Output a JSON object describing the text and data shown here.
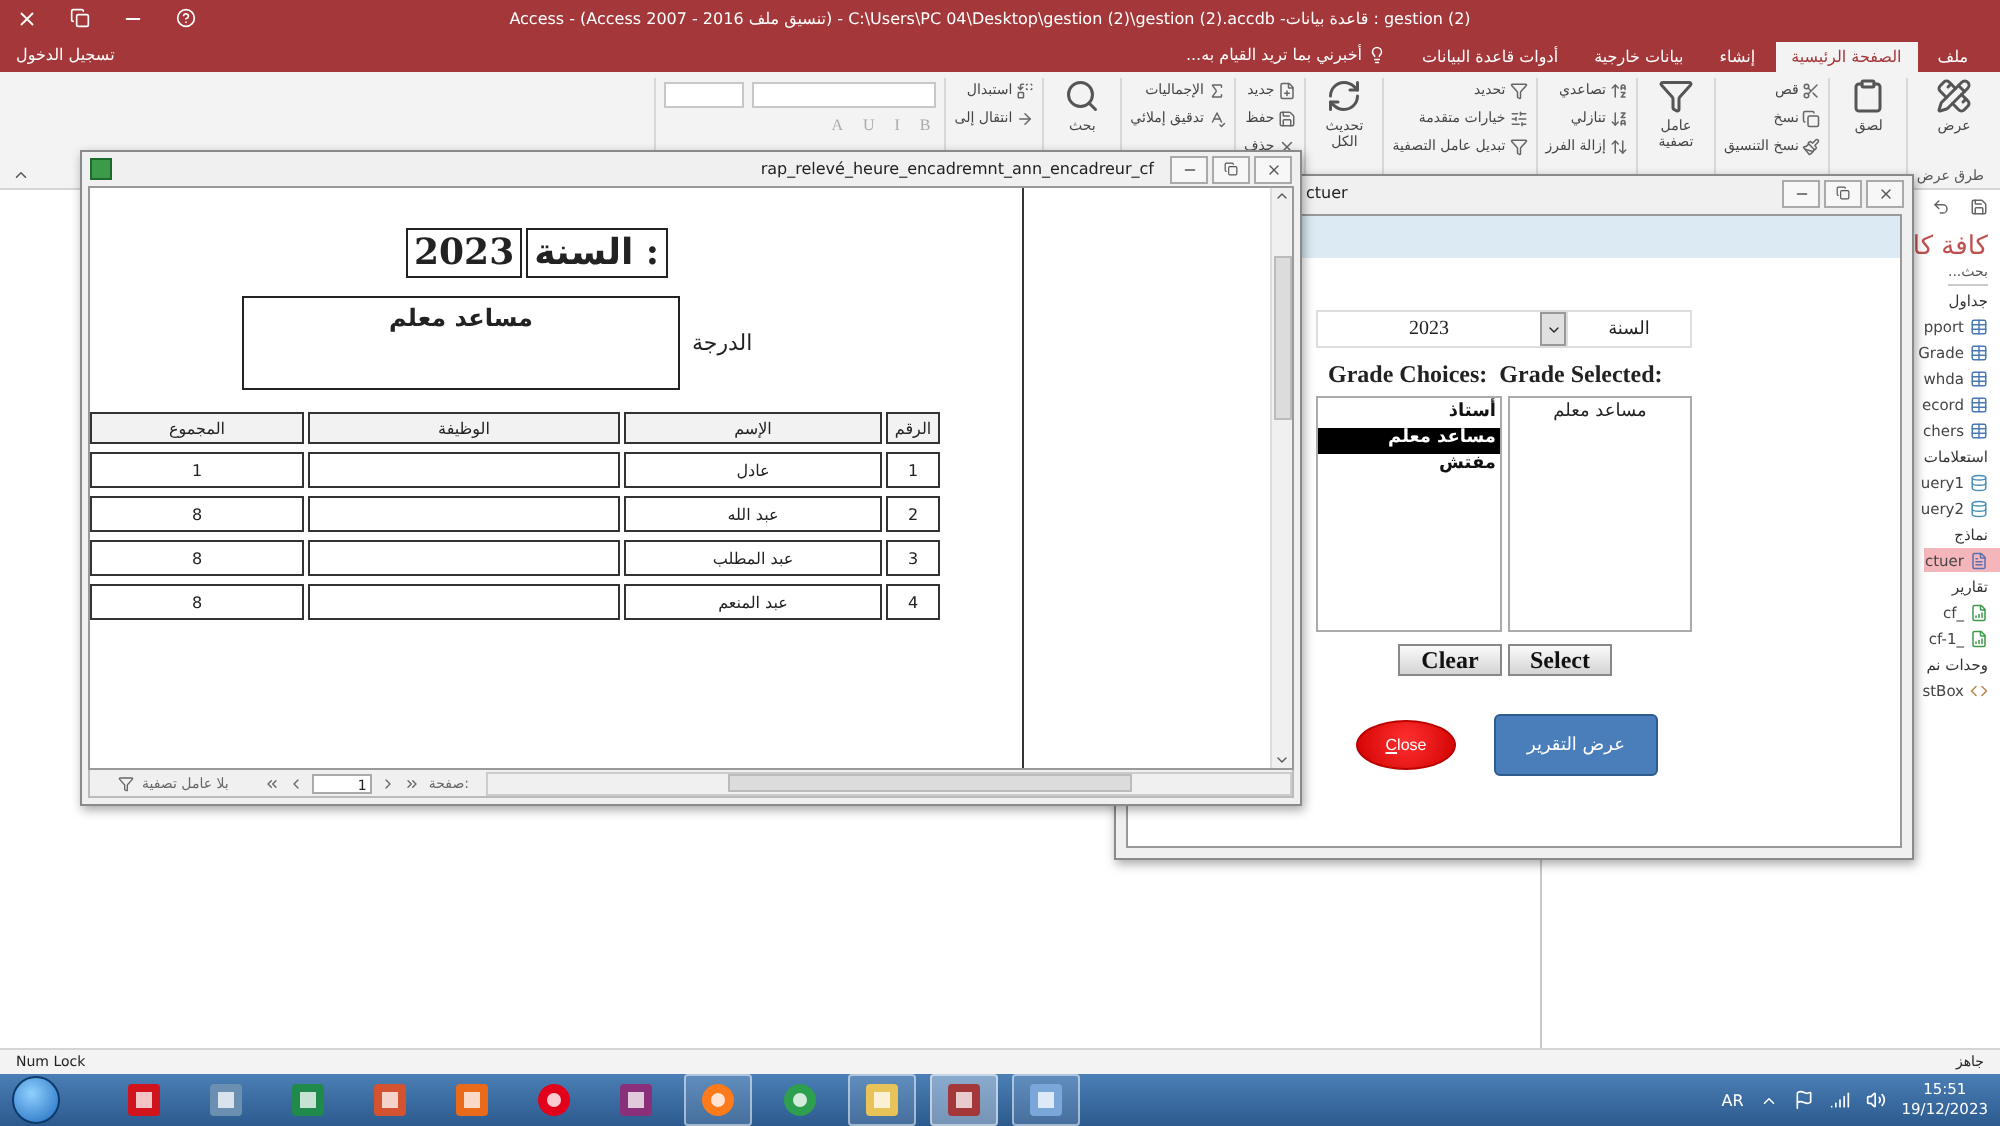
{
  "title_bar": {
    "title": "gestion (2) : قاعدة بيانات- C:\\Users\\PC 04\\Desktop\\gestion (2)\\gestion (2).accdb - (تنسيق ملف Access 2007 - 2016) - Access"
  },
  "ribbon_tabs": {
    "sign_in": "تسجيل الدخول",
    "tell_me": "أخبرني بما تريد القيام به...",
    "tabs": [
      {
        "label": "ملف",
        "selected": false
      },
      {
        "label": "الصفحة الرئيسية",
        "selected": true
      },
      {
        "label": "إنشاء",
        "selected": false
      },
      {
        "label": "بيانات خارجية",
        "selected": false
      },
      {
        "label": "أدوات قاعدة البيانات",
        "selected": false
      }
    ]
  },
  "ribbon": {
    "groups": [
      {
        "caption": "طرق عرض",
        "items": [
          {
            "kind": "large",
            "label": "عرض"
          }
        ]
      },
      {
        "items": [
          {
            "kind": "large",
            "label": "لصق"
          }
        ]
      },
      {
        "items": [
          {
            "kind": "small",
            "label": "قص"
          },
          {
            "kind": "small",
            "label": "نسخ"
          },
          {
            "kind": "small",
            "label": "نسخ التنسيق"
          }
        ]
      },
      {
        "items": [
          {
            "kind": "large",
            "label": "عامل تصفية"
          }
        ]
      },
      {
        "items": [
          {
            "kind": "small",
            "label": "تصاعدي"
          },
          {
            "kind": "small",
            "label": "تنازلي"
          },
          {
            "kind": "small",
            "label": "إزالة الفرز"
          }
        ]
      },
      {
        "items": [
          {
            "kind": "small",
            "label": "تحديد"
          },
          {
            "kind": "small",
            "label": "خيارات متقدمة"
          },
          {
            "kind": "small",
            "label": "تبديل عامل التصفية"
          }
        ]
      },
      {
        "items": [
          {
            "kind": "large",
            "label": "تحديث الكل"
          }
        ]
      },
      {
        "items": [
          {
            "kind": "small",
            "label": "جديد"
          },
          {
            "kind": "small",
            "label": "حفظ"
          },
          {
            "kind": "small",
            "label": "حذف"
          }
        ]
      },
      {
        "items": [
          {
            "kind": "small",
            "label": "الإجماليات"
          },
          {
            "kind": "small",
            "label": "تدقيق إملائي"
          }
        ]
      },
      {
        "items": [
          {
            "kind": "large",
            "label": "بحث"
          }
        ]
      },
      {
        "items": [
          {
            "kind": "small",
            "label": "استبدال"
          },
          {
            "kind": "small",
            "label": "انتقال إلى"
          }
        ]
      },
      {
        "items": [
          {
            "kind": "format",
            "label": "B"
          },
          {
            "kind": "format",
            "label": "I"
          },
          {
            "kind": "format",
            "label": "U"
          },
          {
            "kind": "format",
            "label": "A"
          }
        ]
      }
    ]
  },
  "report": {
    "title": "rap_relevé_heure_encadremnt_ann_encadreur_cf",
    "year_label": "السنة :",
    "year": "2023",
    "grade_label": "الدرجة",
    "grade": "مساعد معلم",
    "columns": [
      "الرقم",
      "الإسم",
      "الوظيفة",
      "المجموع"
    ],
    "rows": [
      {
        "number": "1",
        "name": "عادل",
        "total": "1"
      },
      {
        "number": "2",
        "name": "عبد الله",
        "total": "8"
      },
      {
        "number": "3",
        "name": "عبد المطلب",
        "total": "8"
      },
      {
        "number": "4",
        "name": "عبد المنعم",
        "total": "8"
      }
    ],
    "nav": {
      "filter": "بلا عامل تصفية",
      "page": "1",
      "page_label": "صفحة:"
    }
  },
  "form": {
    "title": "ctuer",
    "year_label": "السنة",
    "year": "2023",
    "choices_label": "Grade Choices:",
    "selected_label": "Grade Selected:",
    "choices": [
      {
        "label": "أستاذ",
        "selected": false
      },
      {
        "label": "مساعد معلم",
        "selected": true
      },
      {
        "label": "مفتش",
        "selected": false
      }
    ],
    "selected_grades": [
      "مساعد معلم"
    ],
    "clear": "Clear",
    "select": "Select",
    "close": "Close",
    "show_report": "عرض التقرير"
  },
  "nav_pane": {
    "title": "كافة كا",
    "search_placeholder": "بحث...",
    "groups": [
      {
        "label": "جداول",
        "items": [
          {
            "label": "pport",
            "kind": "table",
            "selected": false
          },
          {
            "label": "Grade",
            "kind": "table",
            "selected": false
          },
          {
            "label": "whda",
            "kind": "table",
            "selected": false
          },
          {
            "label": "ecord",
            "kind": "table",
            "selected": false
          },
          {
            "label": "chers",
            "kind": "table",
            "selected": false
          }
        ]
      },
      {
        "label": "استعلامات",
        "items": [
          {
            "label": "uery1",
            "kind": "query",
            "selected": false
          },
          {
            "label": "uery2",
            "kind": "query",
            "selected": false
          }
        ]
      },
      {
        "label": "نماذج",
        "items": [
          {
            "label": "ctuer",
            "kind": "form",
            "selected": true
          }
        ]
      },
      {
        "label": "تقارير",
        "items": [
          {
            "label": "_cf",
            "kind": "report",
            "selected": false
          },
          {
            "label": "_cf-1",
            "kind": "report",
            "selected": false
          }
        ]
      },
      {
        "label": "وحدات نم",
        "items": [
          {
            "label": "stBox",
            "kind": "module",
            "selected": false
          }
        ]
      }
    ]
  },
  "status_bar": {
    "left": "Num Lock",
    "right": "جاهز"
  },
  "taskbar": {
    "apps": [
      {
        "kind": "pdf",
        "running": false,
        "selected": false
      },
      {
        "kind": "network",
        "running": false,
        "selected": false
      },
      {
        "kind": "excel",
        "running": false,
        "selected": false
      },
      {
        "kind": "slides",
        "running": false,
        "selected": false
      },
      {
        "kind": "office",
        "running": false,
        "selected": false
      },
      {
        "kind": "opera",
        "running": false,
        "selected": false
      },
      {
        "kind": "archive",
        "running": false,
        "selected": false
      },
      {
        "kind": "firefox",
        "running": true,
        "selected": false
      },
      {
        "kind": "chrome",
        "running": false,
        "selected": false
      },
      {
        "kind": "folder",
        "running": true,
        "selected": false
      },
      {
        "kind": "access",
        "running": true,
        "selected": true
      },
      {
        "kind": "paint",
        "running": true,
        "selected": false
      }
    ],
    "language": "AR",
    "time": "15:51",
    "date": "19/12/2023"
  }
}
